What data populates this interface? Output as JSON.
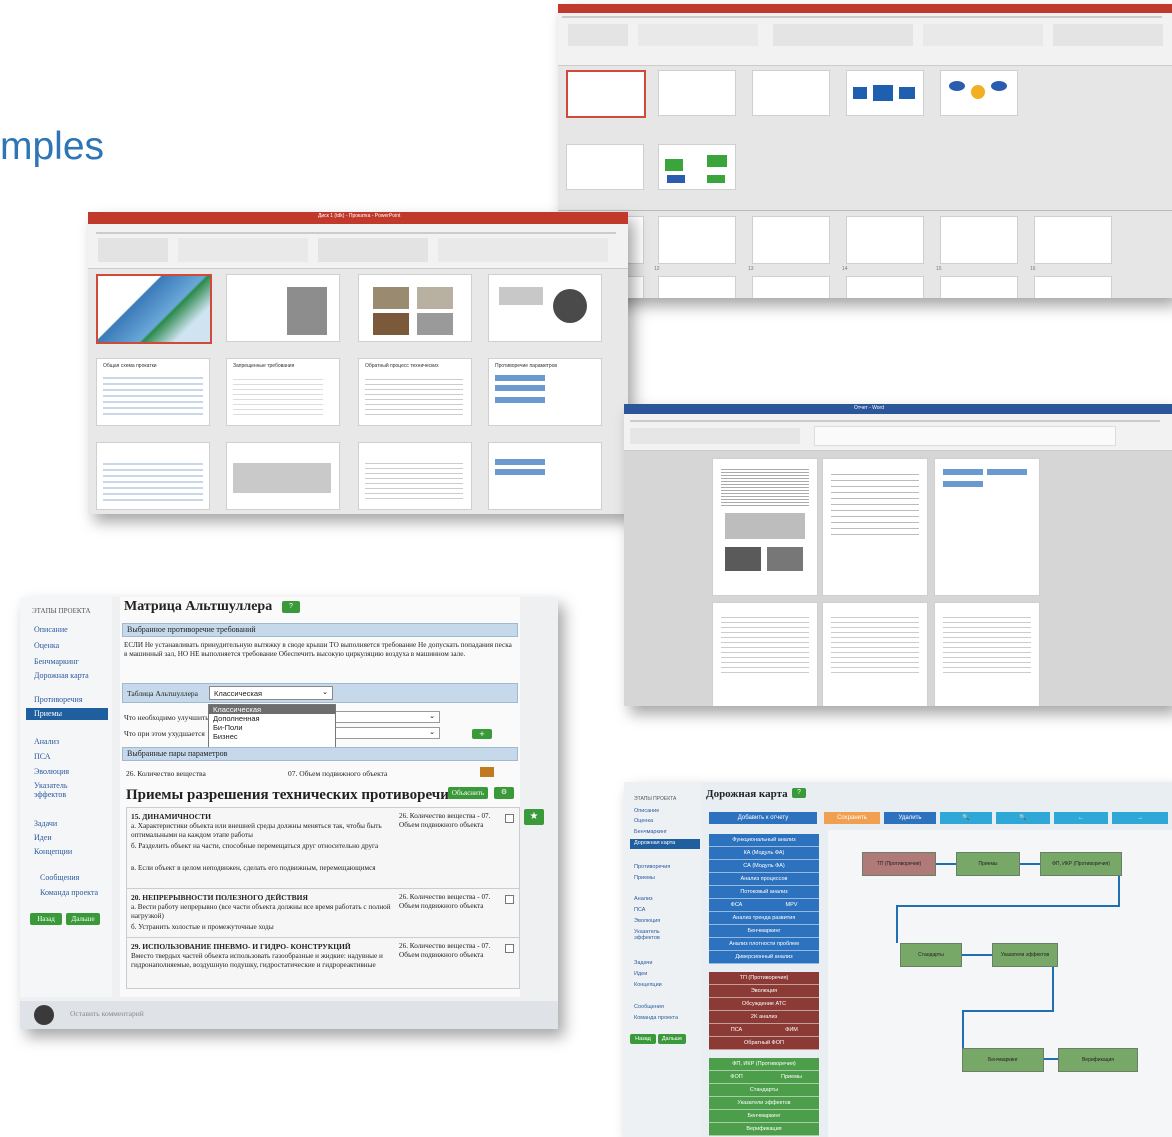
{
  "heading": "mples",
  "ppt_top": {
    "numbers": [
      "12",
      "13",
      "14",
      "15",
      "16"
    ]
  },
  "ppt_mid": {
    "window_title": "Диск 1 (tdk) - Прокатка - PowerPoint",
    "slide_titles": [
      "Общая схема прокатки",
      "Запрещенные требования",
      "Обратный процесс технических",
      "Противоречие параметров"
    ]
  },
  "word": {
    "window_title": "Отчет - Word"
  },
  "altshuller": {
    "sidebar_header": "ЭТАПЫ ПРОЕКТА",
    "sidebar_items": [
      "Описание",
      "Оценка",
      "Бенчмаркинг",
      "Дорожная карта",
      "Противоречия",
      "Приемы",
      "Анализ",
      "ПСА",
      "Эволюция",
      "Указатель эффектов",
      "Задачи",
      "Идеи",
      "Концепции",
      "Сообщения",
      "Команда проекта"
    ],
    "active_item": "Приемы",
    "back_label": "Назад",
    "next_label": "Дальше",
    "title": "Матрица Альтшуллера",
    "title_btn": "?",
    "section_selected": "Выбранное противоречие требований",
    "contradiction_text_1": "ЕСЛИ Не устанавливать принудительную вытяжку в своде крыши ТО выполняется требование Не допускать попадания песка в машинный зал, НО НЕ выполняется требование Обеспечить высокую циркуляцию воздуха в машинном зале.",
    "table_label": "Таблица Альтшуллера",
    "table_value": "Классическая",
    "table_options": [
      "Классическая",
      "Дополненная",
      "Би-Поли",
      "Бизнес"
    ],
    "improve_label": "Что необходимо улучшить",
    "worsen_label": "Что при этом ухудшается",
    "add_btn": "+",
    "pairs_header": "Выбранные пары параметров",
    "pair_left": "26. Количество вещества",
    "pair_right": "07. Объем подвижного объекта",
    "methods_title": "Приемы разрешения технических противоречий",
    "explain_btn": "Объяснить",
    "methods": [
      {
        "title": "15. ДИНАМИЧНОСТИ",
        "lines": [
          "а. Характеристики объекта или внешней среды должны меняться так, чтобы быть оптимальными на каждом этапе работы",
          "б. Разделить объект на части, способные перемещаться друг относительно друга",
          "в. Если объект в целом неподвижен, сделать его подвижным, перемещающимся"
        ],
        "ref": "26. Количество вещества - 07. Объем подвижного объекта"
      },
      {
        "title": "20. НЕПРЕРЫВНОСТИ ПОЛЕЗНОГО ДЕЙСТВИЯ",
        "lines": [
          "а. Вести работу непрерывно (все части объекта должны все время работать с полной нагрузкой)",
          "б. Устранить холостые и промежуточные ходы"
        ],
        "ref": "26. Количество вещества - 07. Объем подвижного объекта"
      },
      {
        "title": "29. ИСПОЛЬЗОВАНИЕ ПНЕВМО- И ГИДРО- КОНСТРУКЦИЙ",
        "lines": [
          "Вместо твердых частей объекта использовать газообразные и жидкие: надувные и гидронаполняемые, воздушную подушку, гидростатические и гидрореактивные"
        ],
        "ref": "26. Количество вещества - 07. Объем подвижного объекта"
      }
    ],
    "comment_placeholder": "Оставить комментарий"
  },
  "roadmap": {
    "title": "Дорожная карта",
    "title_btn": "?",
    "sidebar_header": "ЭТАПЫ ПРОЕКТА",
    "sidebar_items": [
      "Описание",
      "Оценка",
      "Бенчмаркинг",
      "Дорожная карта",
      "Противоречия",
      "Приемы",
      "Анализ",
      "ПСА",
      "Эволюция",
      "Указатель эффектов",
      "Задачи",
      "Идеи",
      "Концепции",
      "Сообщения",
      "Команда проекта"
    ],
    "active_item": "Дорожная карта",
    "back_label": "Назад",
    "next_label": "Дальше",
    "toolbar": [
      "Добавить к отчету",
      "Сохранить",
      "Удалить",
      "🔍",
      "🔍",
      "←",
      "→"
    ],
    "blue_list": [
      "Функциональный анализ",
      "КА (Модуль ФА)",
      "СА (Модуль ФА)",
      "Анализ процессов",
      "Потоковый анализ",
      "ФСА",
      "MPV",
      "Анализ тренда развития",
      "Бенчмаркинг",
      "Анализ плотности проблем",
      "Диверсионный анализ"
    ],
    "red_list": [
      "ТП (Противоречия)",
      "Эволюция",
      "Обсуждение АТС",
      "2K анализ",
      "ПСА",
      "ФИМ",
      "Обратный ФОП"
    ],
    "green_list": [
      "ФП, ИКР (Противоречия)",
      "ФОП",
      "Приемы",
      "Стандарты",
      "Указатели эффектов",
      "Бенчмаркинг",
      "Верификация"
    ],
    "nodes": [
      "ТП (Противоречия)",
      "Приемы",
      "ФП, ИКР (Противоречия)",
      "Стандарты",
      "Указатели эффектов",
      "Бенчмаркинг",
      "Верификация"
    ],
    "colors": {
      "blue": "#2d72bf",
      "red": "#8b3a35",
      "green": "#4c9e4a",
      "node_green": "#78a868",
      "node_red": "#b07a78",
      "connector": "#1f6fb2"
    }
  }
}
